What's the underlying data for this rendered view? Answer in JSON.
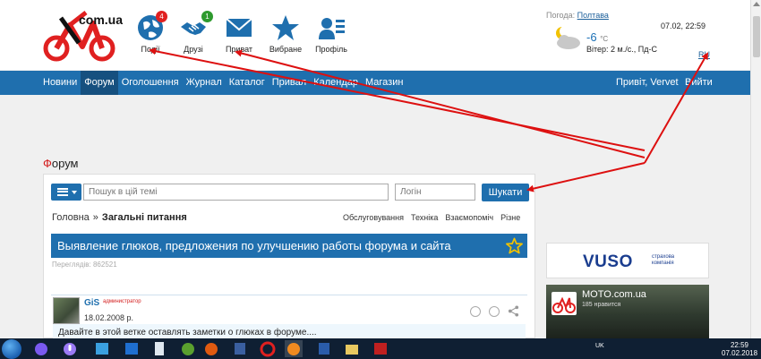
{
  "header": {
    "logo_text": "com.ua",
    "nav_icons": [
      {
        "name": "events",
        "label": "Події",
        "icon": "globe-icon",
        "badge": "4",
        "badge_color": "#e02020"
      },
      {
        "name": "friends",
        "label": "Друзі",
        "icon": "handshake-icon",
        "badge": "1",
        "badge_color": "#2e9a2e"
      },
      {
        "name": "messages",
        "label": "Приват",
        "icon": "envelope-icon",
        "badge": null
      },
      {
        "name": "favorites",
        "label": "Вибране",
        "icon": "star-icon",
        "badge": null
      },
      {
        "name": "profile",
        "label": "Профіль",
        "icon": "user-card-icon",
        "badge": null
      }
    ],
    "weather": {
      "label": "Погода:",
      "city": "Полтава",
      "temp": "-6",
      "unit": "°C",
      "wind": "Вітер: 2 м./с., Пд-С",
      "icon": "cloud-moon-icon"
    },
    "datetime": "07.02, 22:59",
    "lang": "RU"
  },
  "navbar": {
    "items": [
      "Новини",
      "Форум",
      "Оголошення",
      "Журнал",
      "Каталог",
      "Привал",
      "Календар",
      "Магазин"
    ],
    "active": "Форум",
    "greeting": "Привіт, Vervet",
    "logout": "Вийти"
  },
  "forum": {
    "title_first": "Ф",
    "title_rest": "орум",
    "search_placeholder": "Пошук в цій темі",
    "login_placeholder": "Логін",
    "search_button": "Шукати",
    "breadcrumb": {
      "home": "Головна",
      "sep": "»",
      "current": "Загальні питання"
    },
    "subnav": [
      "Обслуговування",
      "Техніка",
      "Взаємопоміч",
      "Різне"
    ],
    "topic_title": "Выявление глюков, предложения по улучшению работы форума и сайта",
    "views": "Переглядів: 862521"
  },
  "post": {
    "author": "GiS",
    "role": "администратор",
    "date": "18.02.2008 р.",
    "body": "Давайте в этой ветке оставлять заметки о глюках в форуме...."
  },
  "sidebar": {
    "ad_logo": "VUSO",
    "ad_sub": "страхова компанія",
    "fb_name": "MOTO.com.ua",
    "fb_likes": "185 нравится"
  },
  "taskbar": {
    "lang": "UK",
    "time": "22:59",
    "date": "07.02.2018"
  },
  "colors": {
    "brand_blue": "#1f6fae",
    "accent_red": "#e02020",
    "arrow_red": "#dd1010"
  }
}
